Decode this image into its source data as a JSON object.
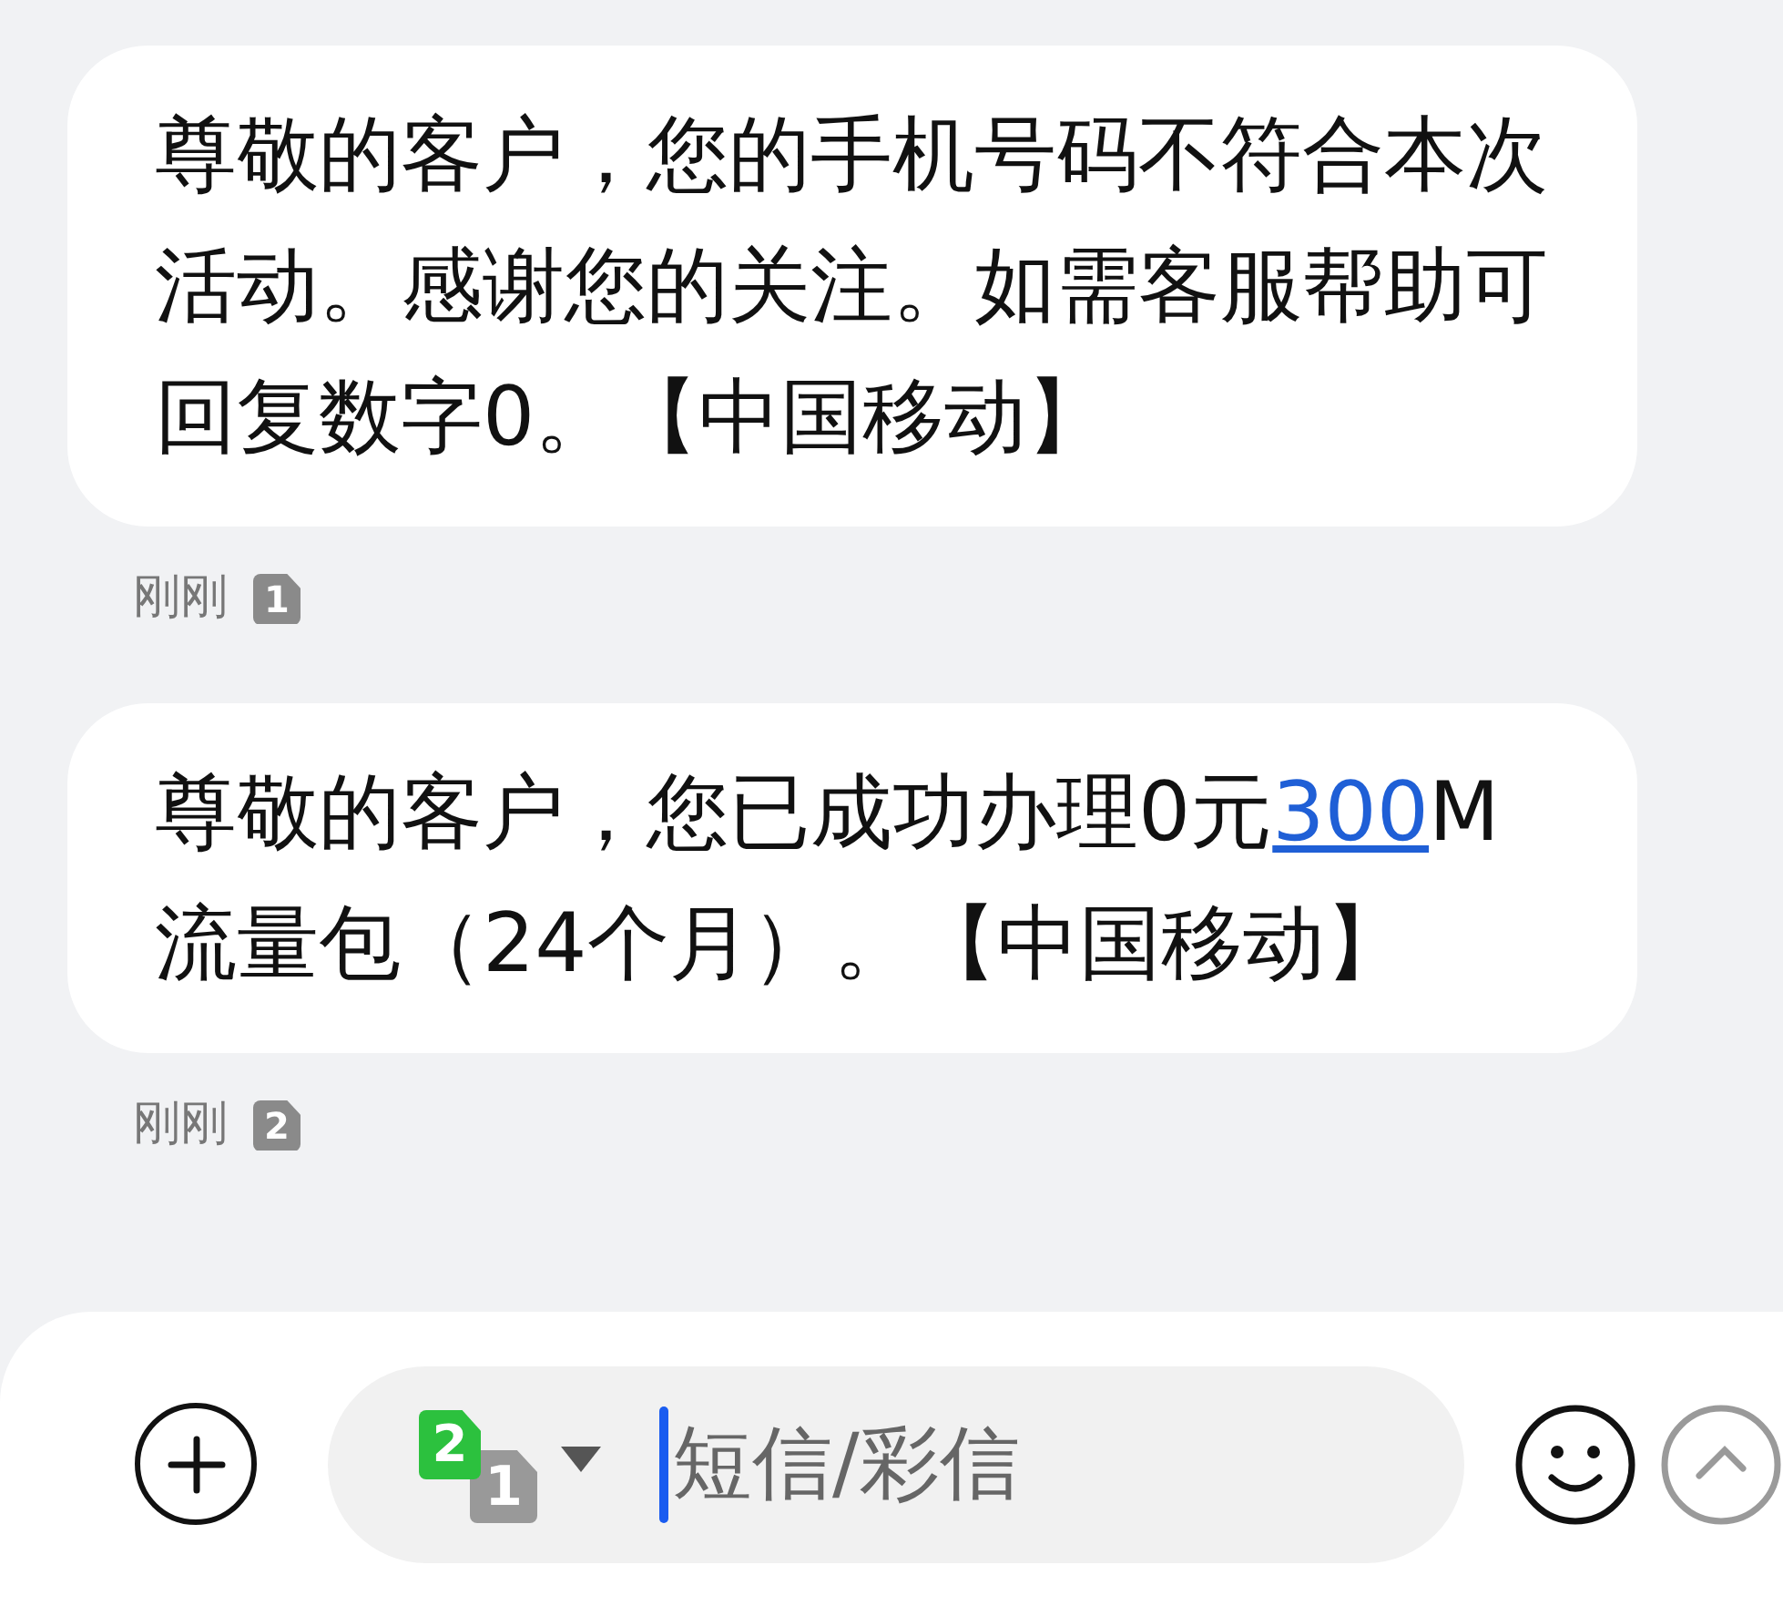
{
  "messages": [
    {
      "parts": [
        {
          "kind": "text",
          "text": "尊敬的客户，您的手机号码不符合本次活动。感谢您的关注。如需客服帮助可回复数字0。【中国移动】"
        }
      ],
      "time": "刚刚",
      "sim": "1"
    },
    {
      "parts": [
        {
          "kind": "text",
          "text": "尊敬的客户，您已成功办理0元"
        },
        {
          "kind": "link",
          "text": "300"
        },
        {
          "kind": "text",
          "text": "M流量包（24个月）。【中国移动】"
        }
      ],
      "time": "刚刚",
      "sim": "2"
    }
  ],
  "composer": {
    "sim_front": "2",
    "sim_back": "1",
    "placeholder": "短信/彩信"
  }
}
